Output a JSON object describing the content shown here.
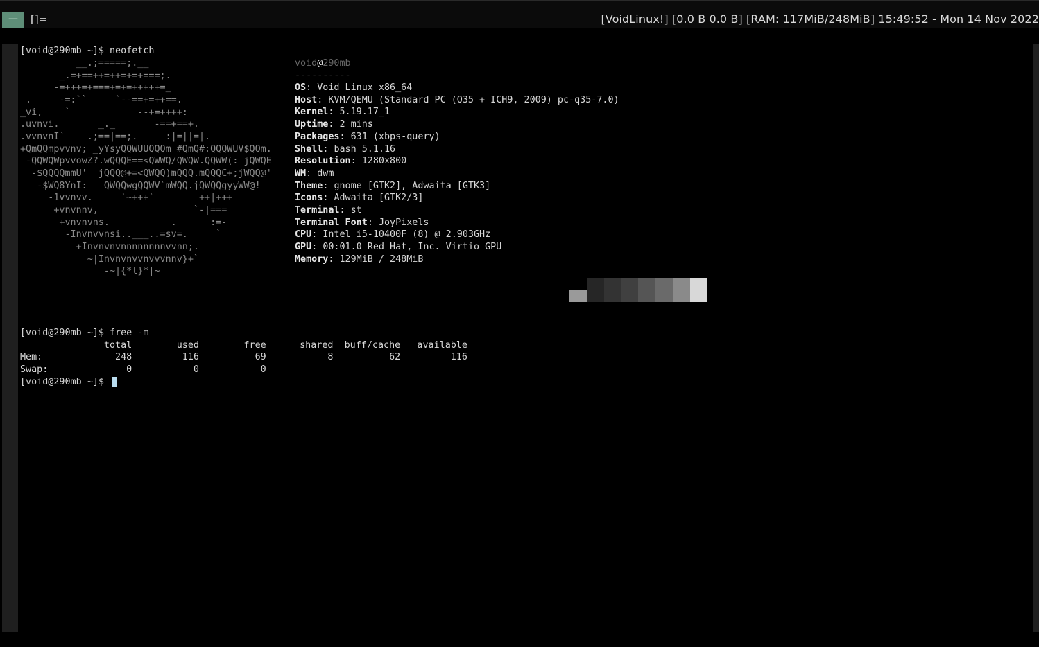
{
  "statusbar": {
    "tag_label": "—",
    "layout_symbol": "[]=",
    "status": "[VoidLinux!] [0.0 B 0.0 B] [RAM: 117MiB/248MiB] 15:49:52 - Mon 14 Nov 2022"
  },
  "terminal": {
    "prompt": "[void@290mb ~]$",
    "command1": "neofetch",
    "logo": [
      "          __.;=====;.__",
      "       _.=+==++=++=+=+===;.",
      "      -=+++=+===+=+=+++++=_",
      " .     -=:``     `--==+=++==.",
      "_vi,    `            --+=++++:",
      ".uvnvi.       _._       -==+==+.",
      ".vvnvnI`    .;==|==;.     :|=||=|.",
      "+QmQQmpvvnv; _yYsyQQWUUQQQm #QmQ#:QQQWUV$QQm.",
      " -QQWQWpvvowZ?.wQQQE==<QWWQ/QWQW.QQWW(: jQWQE",
      "  -$QQQQmmU'  jQQQ@+=<QWQQ)mQQQ.mQQQC+;jWQQ@'",
      "   -$WQ8YnI:   QWQQwgQQWV`mWQQ.jQWQQgyyWW@!",
      "     -1vvnvv.     `~+++`        ++|+++",
      "      +vnvnnv,                 `-|===",
      "       +vnvnvns.           .      :=-",
      "        -Invnvvnsi..___..=sv=.     `",
      "          +Invnvnvnnnnnnnnvvnn;.",
      "            ~|Invnvnvvnvvvnnv}+`",
      "               -~|{*l}*|~"
    ],
    "info": {
      "user": "void",
      "host": "290mb",
      "separator": "----------",
      "fields": [
        {
          "key": "OS",
          "value": "Void Linux x86_64"
        },
        {
          "key": "Host",
          "value": "KVM/QEMU (Standard PC (Q35 + ICH9, 2009) pc-q35-7.0)"
        },
        {
          "key": "Kernel",
          "value": "5.19.17_1"
        },
        {
          "key": "Uptime",
          "value": "2 mins"
        },
        {
          "key": "Packages",
          "value": "631 (xbps-query)"
        },
        {
          "key": "Shell",
          "value": "bash 5.1.16"
        },
        {
          "key": "Resolution",
          "value": "1280x800"
        },
        {
          "key": "WM",
          "value": "dwm"
        },
        {
          "key": "Theme",
          "value": "gnome [GTK2], Adwaita [GTK3]"
        },
        {
          "key": "Icons",
          "value": "Adwaita [GTK2/3]"
        },
        {
          "key": "Terminal",
          "value": "st"
        },
        {
          "key": "Terminal Font",
          "value": "JoyPixels"
        },
        {
          "key": "CPU",
          "value": "Intel i5-10400F (8) @ 2.903GHz"
        },
        {
          "key": "GPU",
          "value": "00:01.0 Red Hat, Inc. Virtio GPU"
        },
        {
          "key": "Memory",
          "value": "129MiB / 248MiB"
        }
      ],
      "palette": [
        "#9a9a9a",
        "#262626",
        "#333333",
        "#404040",
        "#555555",
        "#6a6a6a",
        "#8a8a8a",
        "#d8d8d8"
      ]
    },
    "command2": "free -m",
    "free_output": [
      "               total        used        free      shared  buff/cache   available",
      "Mem:             248         116          69           8          62         116",
      "Swap:              0           0           0"
    ]
  }
}
